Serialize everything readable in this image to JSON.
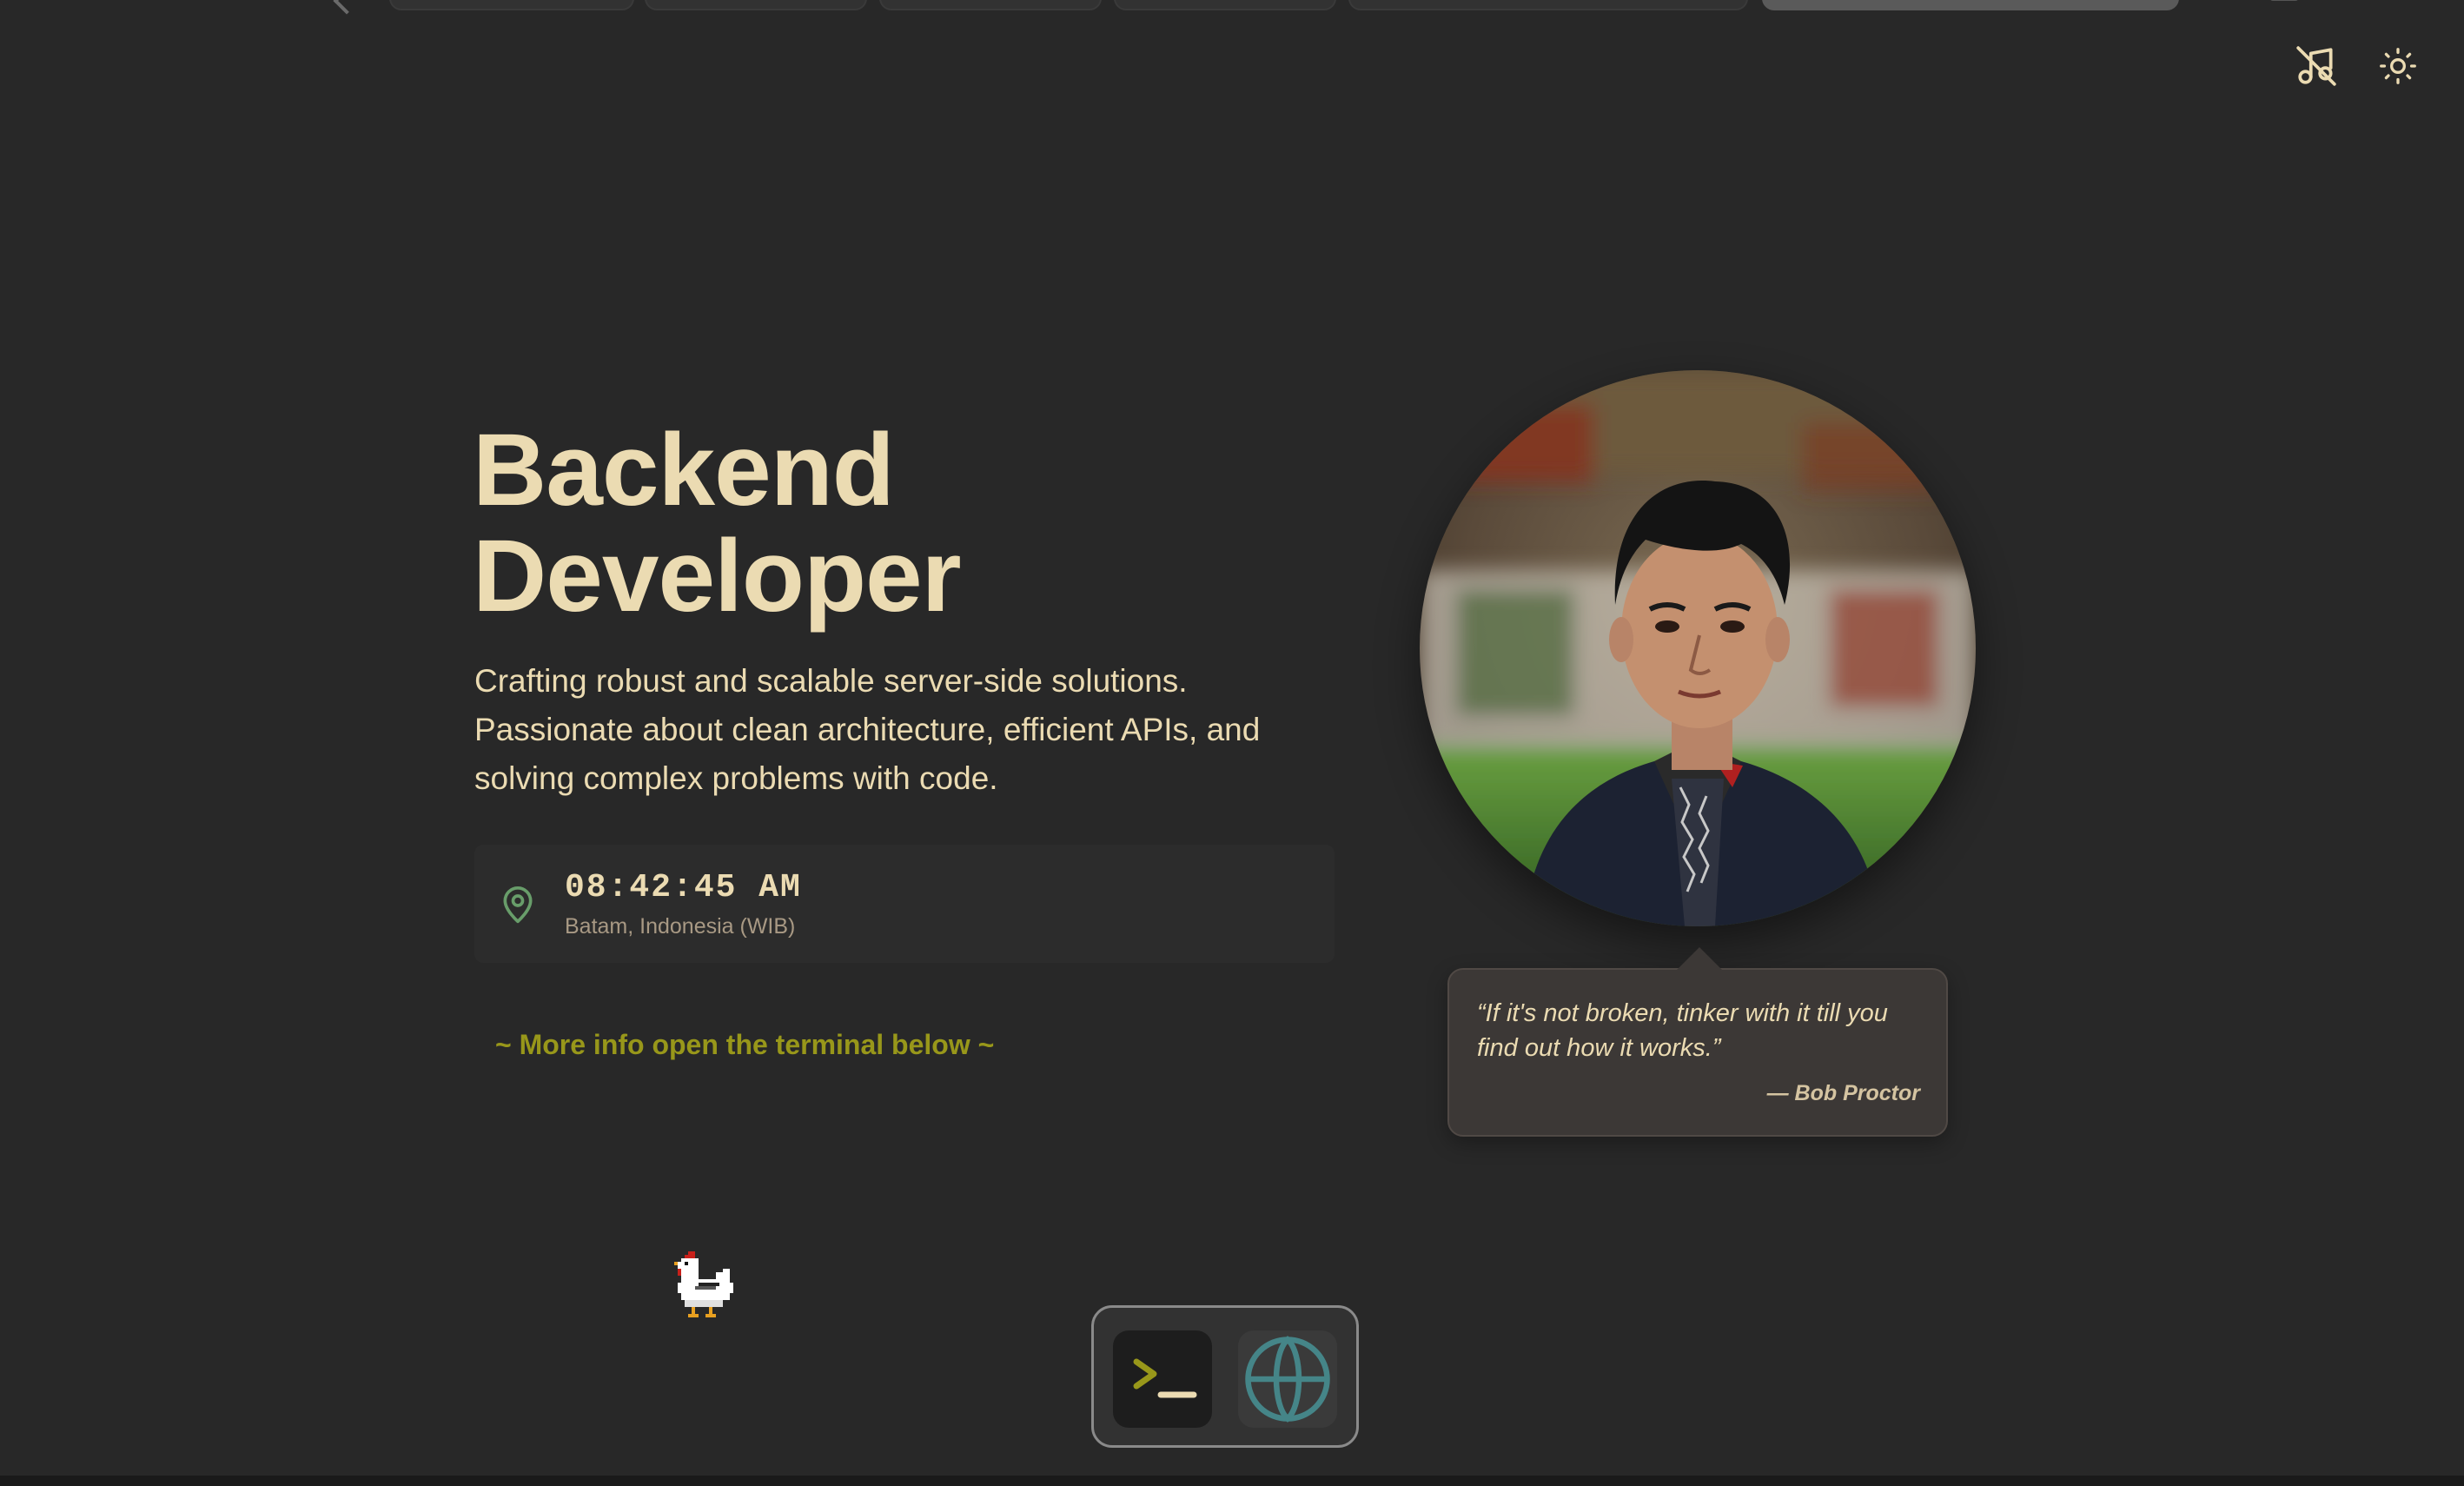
{
  "header": {
    "music_icon": "music-off-icon",
    "theme_icon": "sun-icon"
  },
  "hero": {
    "title_line1": "Backend",
    "title_line2": "Developer",
    "description": "Crafting robust and scalable server-side solutions. Passionate about clean architecture, efficient APIs, and solving complex problems with code."
  },
  "clock": {
    "icon": "location-pin-icon",
    "time": "08:42:45 AM",
    "location": "Batam, Indonesia (WIB)"
  },
  "hint": {
    "text": "~ More info open the terminal below ~"
  },
  "quote": {
    "text": "“If it's not broken, tinker with it till you find out how it works.”",
    "author": "— Bob Proctor"
  },
  "dock": {
    "items": [
      {
        "icon": "terminal-icon"
      },
      {
        "icon": "globe-icon"
      }
    ]
  },
  "colors": {
    "background": "#282828",
    "foreground": "#ebdbb2",
    "accent_yellow": "#98971a",
    "accent_green": "#689d6a",
    "accent_aqua": "#458588"
  }
}
